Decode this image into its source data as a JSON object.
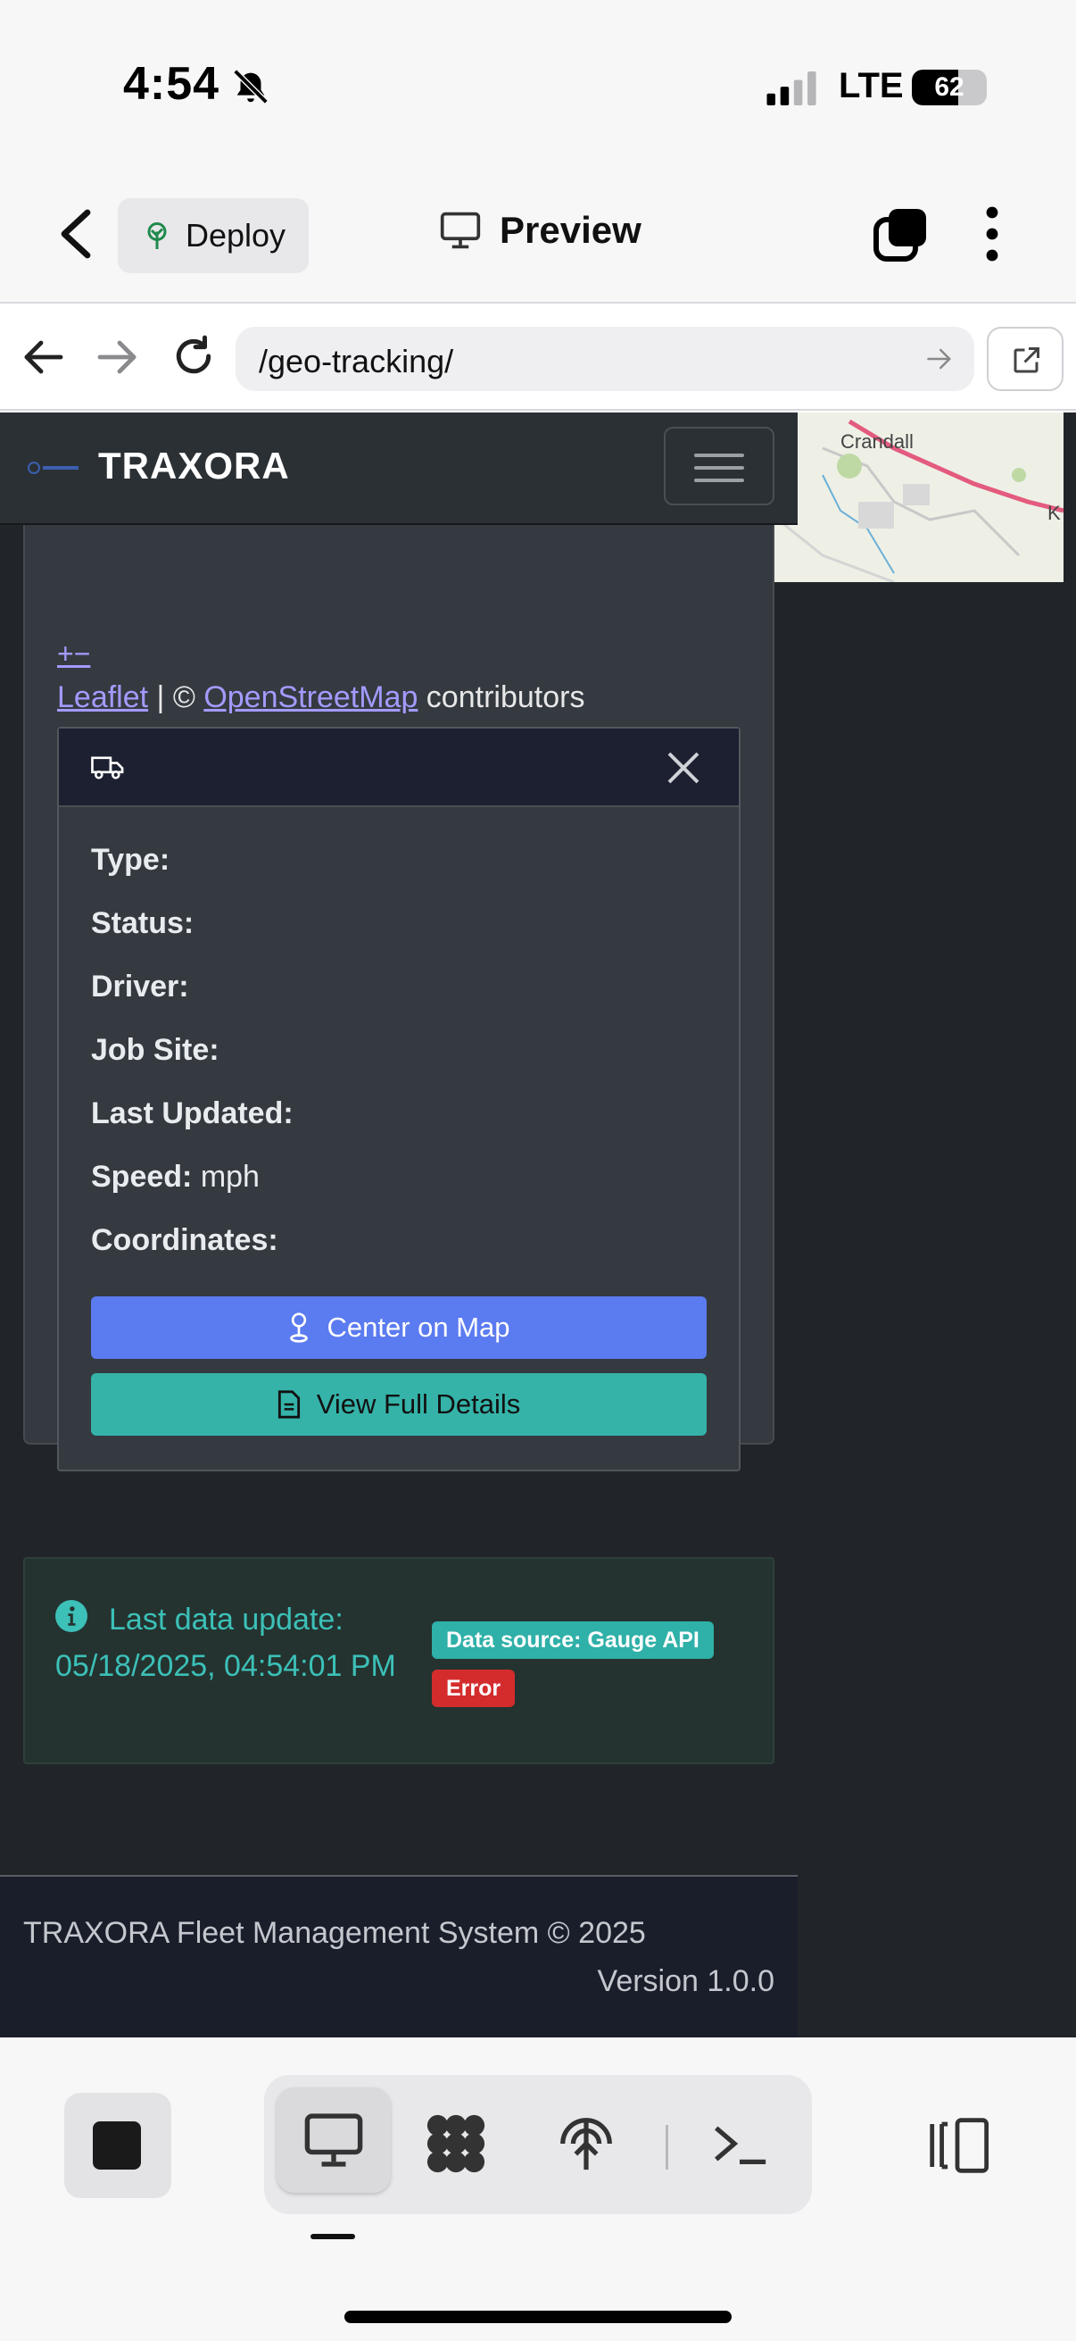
{
  "status_bar": {
    "time": "4:54",
    "network": "LTE",
    "battery": "62",
    "battery_level": 0.62
  },
  "app_bar": {
    "deploy_label": "Deploy",
    "title": "Preview"
  },
  "browser": {
    "url": "/geo-tracking/"
  },
  "navbar": {
    "brand": "TRAXORA"
  },
  "map": {
    "place_label": "Crandall",
    "edge_label": "K",
    "zoom_control": "+−",
    "attribution": {
      "leaflet": "Leaflet",
      "separator": " | © ",
      "osm": "OpenStreetMap",
      "suffix": " contributors"
    }
  },
  "popup": {
    "fields": [
      {
        "label": "Type:",
        "value": ""
      },
      {
        "label": "Status:",
        "value": ""
      },
      {
        "label": "Driver:",
        "value": ""
      },
      {
        "label": "Job Site:",
        "value": ""
      },
      {
        "label": "Last Updated:",
        "value": ""
      },
      {
        "label": "Speed:",
        "value": "mph"
      },
      {
        "label": "Coordinates:",
        "value": ""
      }
    ],
    "center_button": "Center on Map",
    "details_button": "View Full Details"
  },
  "alert": {
    "text": "Last data update: 05/18/2025, 04:54:01 PM",
    "source_badge": "Data source: Gauge API",
    "error_badge": "Error"
  },
  "footer": {
    "copyright": "TRAXORA Fleet Management System © 2025",
    "version": "Version 1.0.0"
  },
  "icons": {
    "status": [
      "bell-off-icon",
      "signal-icon",
      "battery-icon"
    ],
    "app_bar": [
      "back-chevron-icon",
      "deploy-tree-icon",
      "monitor-icon",
      "tabs-icon",
      "more-vertical-icon"
    ],
    "browser": [
      "arrow-left-icon",
      "arrow-right-icon",
      "reload-icon",
      "go-arrow-icon",
      "open-external-icon"
    ],
    "bottom": [
      "stop-icon",
      "monitor-icon",
      "workflow-icon",
      "deploy-icon",
      "terminal-icon",
      "panel-icon"
    ]
  },
  "colors": {
    "primary_button": "#5b7bf0",
    "teal_button": "#35b3a9",
    "error_badge": "#d42c2c",
    "page_bg": "#212529",
    "link": "#a29bfe"
  }
}
